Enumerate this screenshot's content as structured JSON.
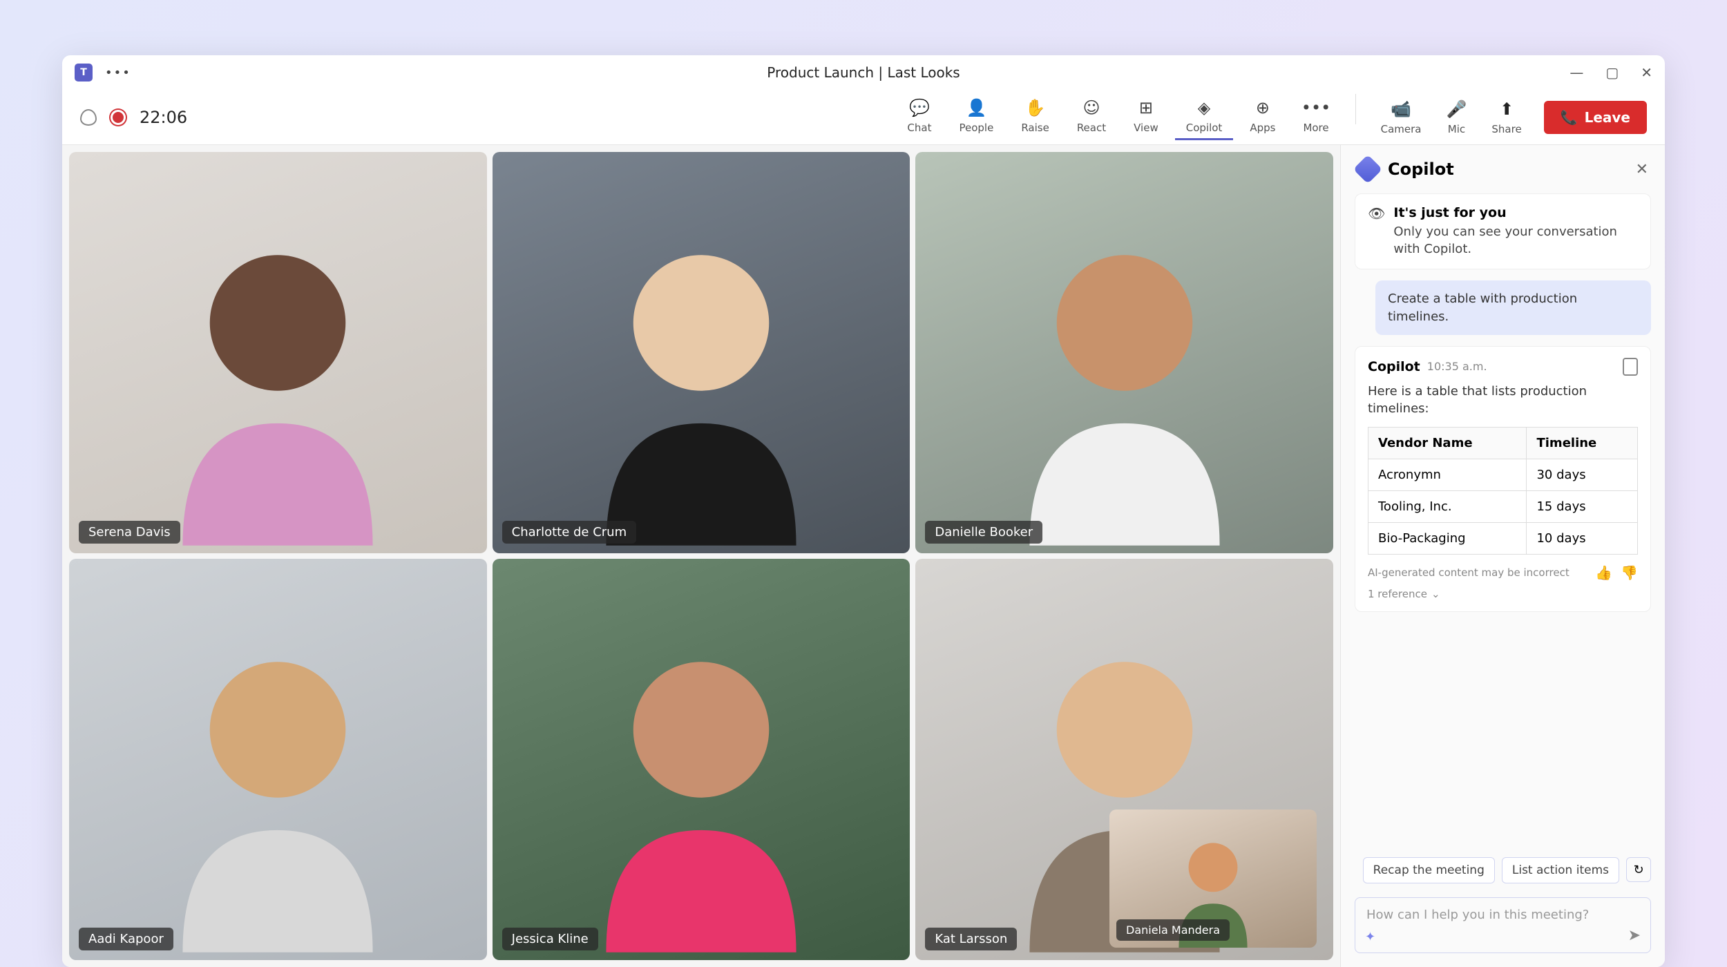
{
  "titlebar": {
    "meeting_title": "Product Launch | Last Looks"
  },
  "toolbar": {
    "timer": "22:06",
    "items": {
      "chat": "Chat",
      "people": "People",
      "raise": "Raise",
      "react": "React",
      "view": "View",
      "copilot": "Copilot",
      "apps": "Apps",
      "more": "More"
    },
    "devices": {
      "camera": "Camera",
      "mic": "Mic",
      "share": "Share"
    },
    "leave_label": "Leave"
  },
  "participants": {
    "p1": "Serena Davis",
    "p2": "Charlotte de Crum",
    "p3": "Danielle Booker",
    "p4": "Aadi Kapoor",
    "p5": "Jessica Kline",
    "p6": "Kat Larsson",
    "pip": "Daniela Mandera"
  },
  "copilot": {
    "title": "Copilot",
    "notice": {
      "title": "It's just for you",
      "text": "Only you can see your conversation with Copilot."
    },
    "user_message": "Create a table with production timelines.",
    "response": {
      "name": "Copilot",
      "time": "10:35 a.m.",
      "intro": "Here is a table that lists production timelines:",
      "headers": {
        "col1": "Vendor Name",
        "col2": "Timeline"
      },
      "rows": [
        {
          "vendor": "Acronymn",
          "timeline": "30 days"
        },
        {
          "vendor": "Tooling, Inc.",
          "timeline": "15 days"
        },
        {
          "vendor": "Bio-Packaging",
          "timeline": "10 days"
        }
      ],
      "disclaimer": "AI-generated content may be incorrect",
      "reference": "1 reference"
    },
    "suggestions": {
      "s1": "Recap the meeting",
      "s2": "List action items"
    },
    "input_placeholder": "How can I help you in this meeting?"
  }
}
